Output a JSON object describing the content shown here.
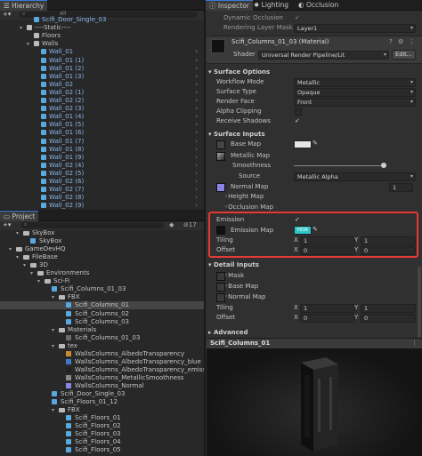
{
  "hierarchy": {
    "tab": "Hierarchy",
    "search_placeholder": "All",
    "rows": [
      {
        "label": "Scifi_Door_Single_03",
        "type": "cube",
        "blue": true,
        "indent": 1
      },
      {
        "label": "----Static----",
        "type": "go",
        "blue": false,
        "indent": 0
      },
      {
        "label": "Floors",
        "type": "go",
        "blue": false,
        "indent": 1
      },
      {
        "label": "Walls",
        "type": "go",
        "blue": false,
        "indent": 1
      },
      {
        "label": "Wall_01",
        "type": "cube",
        "blue": true,
        "indent": 2
      },
      {
        "label": "Wall_01 (1)",
        "type": "cube",
        "blue": true,
        "indent": 2
      },
      {
        "label": "Wall_01 (2)",
        "type": "cube",
        "blue": true,
        "indent": 2
      },
      {
        "label": "Wall_01 (3)",
        "type": "cube",
        "blue": true,
        "indent": 2
      },
      {
        "label": "Wall_02",
        "type": "cube",
        "blue": true,
        "indent": 2
      },
      {
        "label": "Wall_02 (1)",
        "type": "cube",
        "blue": true,
        "indent": 2
      },
      {
        "label": "Wall_02 (2)",
        "type": "cube",
        "blue": true,
        "indent": 2
      },
      {
        "label": "Wall_02 (3)",
        "type": "cube",
        "blue": true,
        "indent": 2
      },
      {
        "label": "Wall_01 (4)",
        "type": "cube",
        "blue": true,
        "indent": 2
      },
      {
        "label": "Wall_01 (5)",
        "type": "cube",
        "blue": true,
        "indent": 2
      },
      {
        "label": "Wall_01 (6)",
        "type": "cube",
        "blue": true,
        "indent": 2
      },
      {
        "label": "Wall_01 (7)",
        "type": "cube",
        "blue": true,
        "indent": 2
      },
      {
        "label": "Wall_01 (8)",
        "type": "cube",
        "blue": true,
        "indent": 2
      },
      {
        "label": "Wall_01 (9)",
        "type": "cube",
        "blue": true,
        "indent": 2
      },
      {
        "label": "Wall_02 (4)",
        "type": "cube",
        "blue": true,
        "indent": 2
      },
      {
        "label": "Wall_02 (5)",
        "type": "cube",
        "blue": true,
        "indent": 2
      },
      {
        "label": "Wall_02 (6)",
        "type": "cube",
        "blue": true,
        "indent": 2
      },
      {
        "label": "Wall_02 (7)",
        "type": "cube",
        "blue": true,
        "indent": 2
      },
      {
        "label": "Wall_02 (8)",
        "type": "cube",
        "blue": true,
        "indent": 2
      },
      {
        "label": "Wall_02 (9)",
        "type": "cube",
        "blue": true,
        "indent": 2
      }
    ]
  },
  "project": {
    "tab": "Project",
    "count_badge": "17",
    "rows": [
      {
        "label": "SkyBox",
        "type": "folder",
        "indent": 1,
        "sel": false
      },
      {
        "label": "SkyBox",
        "type": "cube",
        "indent": 2,
        "sel": false
      },
      {
        "label": "GameDevHQ",
        "type": "folder",
        "indent": 0,
        "sel": false
      },
      {
        "label": "FileBase",
        "type": "folder",
        "indent": 1,
        "sel": false
      },
      {
        "label": "3D",
        "type": "folder",
        "indent": 2,
        "sel": false
      },
      {
        "label": "Environments",
        "type": "folder",
        "indent": 3,
        "sel": false
      },
      {
        "label": "Sci-Fi",
        "type": "folder",
        "indent": 4,
        "sel": false
      },
      {
        "label": "Scifi_Columns_01_03",
        "type": "cube",
        "indent": 5,
        "sel": false
      },
      {
        "label": "FBX",
        "type": "folder",
        "indent": 6,
        "sel": false
      },
      {
        "label": "Scifi_Columns_01",
        "type": "cube",
        "indent": 7,
        "sel": true
      },
      {
        "label": "Scifi_Columns_02",
        "type": "cube",
        "indent": 7,
        "sel": false
      },
      {
        "label": "Scifi_Columns_03",
        "type": "cube",
        "indent": 7,
        "sel": false
      },
      {
        "label": "Materials",
        "type": "folder",
        "indent": 6,
        "sel": false
      },
      {
        "label": "Scifi_Columns_01_03",
        "type": "mat",
        "indent": 7,
        "sel": false
      },
      {
        "label": "tex",
        "type": "folder",
        "indent": 6,
        "sel": false
      },
      {
        "label": "WallsColumns_AlbedoTransparency",
        "type": "tex_orange",
        "indent": 7,
        "sel": false
      },
      {
        "label": "WallsColumns_AlbedoTransparency_blue",
        "type": "tex_blue",
        "indent": 7,
        "sel": false
      },
      {
        "label": "WallsColumns_AlbedoTransparency_emission",
        "type": "tex_dark",
        "indent": 7,
        "sel": false
      },
      {
        "label": "WallsColumns_MetallicSmoothness",
        "type": "tex_gray",
        "indent": 7,
        "sel": false
      },
      {
        "label": "WallsColumns_Normal",
        "type": "tex_purple",
        "indent": 7,
        "sel": false
      },
      {
        "label": "Scifi_Door_Single_03",
        "type": "cube",
        "indent": 5,
        "sel": false
      },
      {
        "label": "Scifi_Floors_01_12",
        "type": "cube",
        "indent": 5,
        "sel": false
      },
      {
        "label": "FBX",
        "type": "folder",
        "indent": 6,
        "sel": false
      },
      {
        "label": "Scifi_Floors_01",
        "type": "cube",
        "indent": 7,
        "sel": false
      },
      {
        "label": "Scifi_Floors_02",
        "type": "cube",
        "indent": 7,
        "sel": false
      },
      {
        "label": "Scifi_Floors_03",
        "type": "cube",
        "indent": 7,
        "sel": false
      },
      {
        "label": "Scifi_Floors_04",
        "type": "cube",
        "indent": 7,
        "sel": false
      },
      {
        "label": "Scifi_Floors_05",
        "type": "cube",
        "indent": 7,
        "sel": false
      }
    ]
  },
  "inspector": {
    "tabs": [
      "Inspector",
      "Lighting",
      "Occlusion"
    ],
    "top": {
      "dynamic_occlusion": "Dynamic Occlusion",
      "rendering_layer_mask": "Rendering Layer Mask",
      "rendering_layer_value": "Layer1"
    },
    "material": {
      "name": "Scifi_Columns_01_03 (Material)",
      "shader_label": "Shader",
      "shader_value": "Universal Render Pipeline/Lit",
      "edit_button": "Edit..."
    },
    "surface_options": {
      "title": "Surface Options",
      "workflow_label": "Workflow Mode",
      "workflow_value": "Metallic",
      "surface_type_label": "Surface Type",
      "surface_type_value": "Opaque",
      "render_face_label": "Render Face",
      "render_face_value": "Front",
      "alpha_clipping_label": "Alpha Clipping",
      "receive_shadows_label": "Receive Shadows"
    },
    "surface_inputs": {
      "title": "Surface Inputs",
      "base_map": "Base Map",
      "metallic_map": "Metallic Map",
      "smoothness": "Smoothness",
      "source_label": "Source",
      "source_value": "Metallic Alpha",
      "normal_map": "Normal Map",
      "normal_value": "1",
      "height_map": "Height Map",
      "occlusion_map": "Occlusion Map",
      "emission_label": "Emission",
      "emission_map": "Emission Map",
      "emission_hdr": "HDR",
      "tiling_label": "Tiling",
      "tiling_x": "1",
      "tiling_y": "1",
      "offset_label": "Offset",
      "offset_x": "0",
      "offset_y": "0",
      "x": "X",
      "y": "Y"
    },
    "detail_inputs": {
      "title": "Detail Inputs",
      "mask": "Mask",
      "base_map": "Base Map",
      "normal_map": "Normal Map",
      "tiling_label": "Tiling",
      "tiling_x": "1",
      "tiling_y": "1",
      "offset_label": "Offset",
      "offset_x": "0",
      "offset_y": "0",
      "x": "X",
      "y": "Y"
    },
    "advanced": "Advanced",
    "preview_title": "Scifi_Columns_01"
  },
  "colors": {
    "highlight_red": "#e53935",
    "emission_cyan": "#2ec4c4",
    "normal_purple": "#8a84e8",
    "accent_blue": "#3a7bd5"
  }
}
